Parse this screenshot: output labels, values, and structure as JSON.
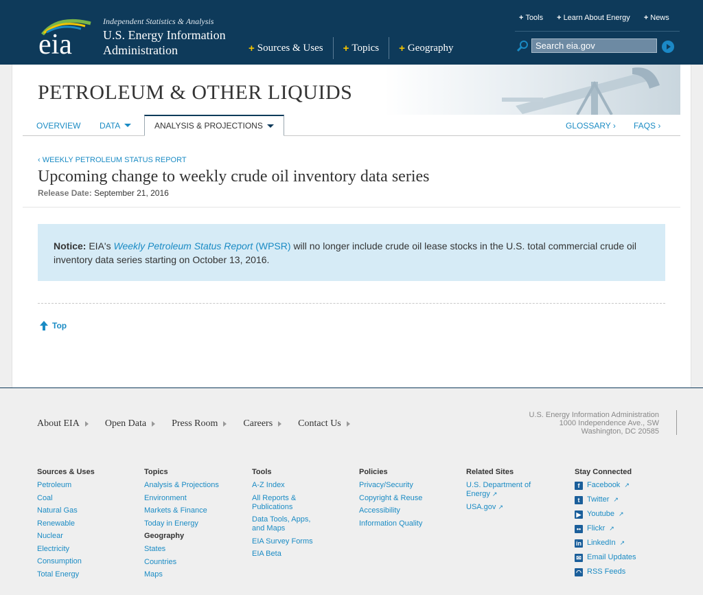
{
  "header": {
    "tagline": "Independent Statistics & Analysis",
    "org_name_line1": "U.S. Energy Information",
    "org_name_line2": "Administration",
    "logo_text": "eia",
    "util_nav": [
      "Tools",
      "Learn About Energy",
      "News"
    ],
    "main_nav": [
      "Sources & Uses",
      "Topics",
      "Geography"
    ],
    "search_placeholder": "Search eia.gov"
  },
  "banner": {
    "title": "PETROLEUM & OTHER LIQUIDS"
  },
  "subnav": {
    "overview": "OVERVIEW",
    "data": "DATA",
    "analysis": "ANALYSIS & PROJECTIONS",
    "glossary": "GLOSSARY ›",
    "faqs": "FAQS ›"
  },
  "article": {
    "breadcrumb": "‹ WEEKLY PETROLEUM STATUS REPORT",
    "title": "Upcoming change to weekly crude oil inventory data series",
    "release_label": "Release Date:",
    "release_date": "September 21, 2016",
    "notice_label": "Notice:",
    "notice_pre": "EIA's",
    "notice_link": "Weekly Petroleum Status Report",
    "notice_abbr": "(WPSR)",
    "notice_post": "will no longer include crude oil lease stocks in the U.S. total commercial crude oil inventory data series starting on October 13, 2016.",
    "top_link": "Top"
  },
  "footer": {
    "nav": [
      "About EIA",
      "Open Data",
      "Press Room",
      "Careers",
      "Contact Us"
    ],
    "address": [
      "U.S. Energy Information Administration",
      "1000 Independence Ave., SW",
      "Washington, DC 20585"
    ],
    "sources": {
      "heading": "Sources & Uses",
      "links": [
        "Petroleum",
        "Coal",
        "Natural Gas",
        "Renewable",
        "Nuclear",
        "Electricity",
        "Consumption",
        "Total Energy"
      ]
    },
    "topics": {
      "heading": "Topics",
      "links": [
        "Analysis & Projections",
        "Environment",
        "Markets & Finance",
        "Today in Energy"
      ],
      "sub_heading": "Geography",
      "sub_links": [
        "States",
        "Countries",
        "Maps"
      ]
    },
    "tools": {
      "heading": "Tools",
      "links": [
        "A-Z Index",
        "All Reports & Publications",
        "Data Tools, Apps, and Maps",
        "EIA Survey Forms",
        "EIA Beta"
      ]
    },
    "policies": {
      "heading": "Policies",
      "links": [
        "Privacy/Security",
        "Copyright & Reuse",
        "Accessibility",
        "Information Quality"
      ]
    },
    "related": {
      "heading": "Related Sites",
      "links": [
        "U.S. Department of Energy",
        "USA.gov"
      ]
    },
    "social": {
      "heading": "Stay Connected",
      "links": [
        "Facebook",
        "Twitter",
        "Youtube",
        "Flickr",
        "LinkedIn",
        "Email Updates",
        "RSS Feeds"
      ]
    }
  },
  "colors": {
    "header_bg": "#0e3a5a",
    "link": "#1a8bc4",
    "notice_bg": "#d6ebf6",
    "accent_plus": "#f5c400"
  }
}
